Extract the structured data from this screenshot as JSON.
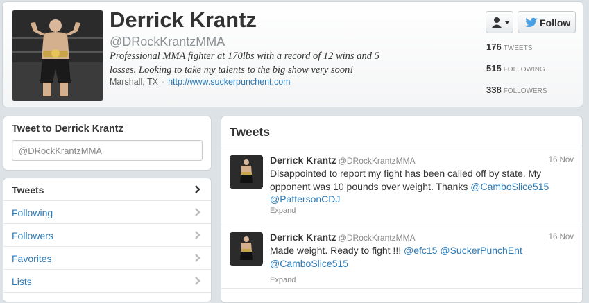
{
  "profile": {
    "name": "Derrick Krantz",
    "handle": "@DRockKrantzMMA",
    "bio": "Professional MMA fighter at 170lbs with a record of 12 wins and 5 losses. Looking to take my talents to the big show very soon!",
    "location": "Marshall, TX",
    "separator": "·",
    "url": "http://www.suckerpunchent.com",
    "follow_label": "Follow",
    "stats": {
      "tweets": {
        "count": "176",
        "label": "TWEETS"
      },
      "following": {
        "count": "515",
        "label": "FOLLOWING"
      },
      "followers": {
        "count": "338",
        "label": "FOLLOWERS"
      }
    }
  },
  "tweet_box": {
    "title": "Tweet to Derrick Krantz",
    "value": "@DRockKrantzMMA"
  },
  "nav": {
    "items": [
      {
        "label": "Tweets",
        "active": true
      },
      {
        "label": "Following"
      },
      {
        "label": "Followers"
      },
      {
        "label": "Favorites"
      },
      {
        "label": "Lists"
      }
    ]
  },
  "timeline": {
    "header": "Tweets",
    "tweets": [
      {
        "name": "Derrick Krantz",
        "handle": "@DRockKrantzMMA",
        "date": "16 Nov",
        "text_plain": "Disappointed to report my fight has been called off by state. My opponent was 10 pounds over weight. Thanks ",
        "mention1": "@CamboSlice515",
        "mention2": "@PattersonCDJ",
        "expand": "Expand"
      },
      {
        "name": "Derrick Krantz",
        "handle": "@DRockKrantzMMA",
        "date": "16 Nov",
        "text_plain": "Made weight. Ready to fight !!! ",
        "mention1": "@efc15",
        "mention2": "@SuckerPunchEnt",
        "mention3": "@CamboSlice515",
        "expand": "Expand"
      }
    ]
  },
  "colors": {
    "link": "#2b7bb9",
    "follow_bird": "#4aa0e2",
    "page_bg": "#dde2e6"
  },
  "icons": {
    "user_menu": "person-icon",
    "caret": "caret-down-icon",
    "follow": "bird-icon",
    "chevron": "chevron-right-icon"
  }
}
